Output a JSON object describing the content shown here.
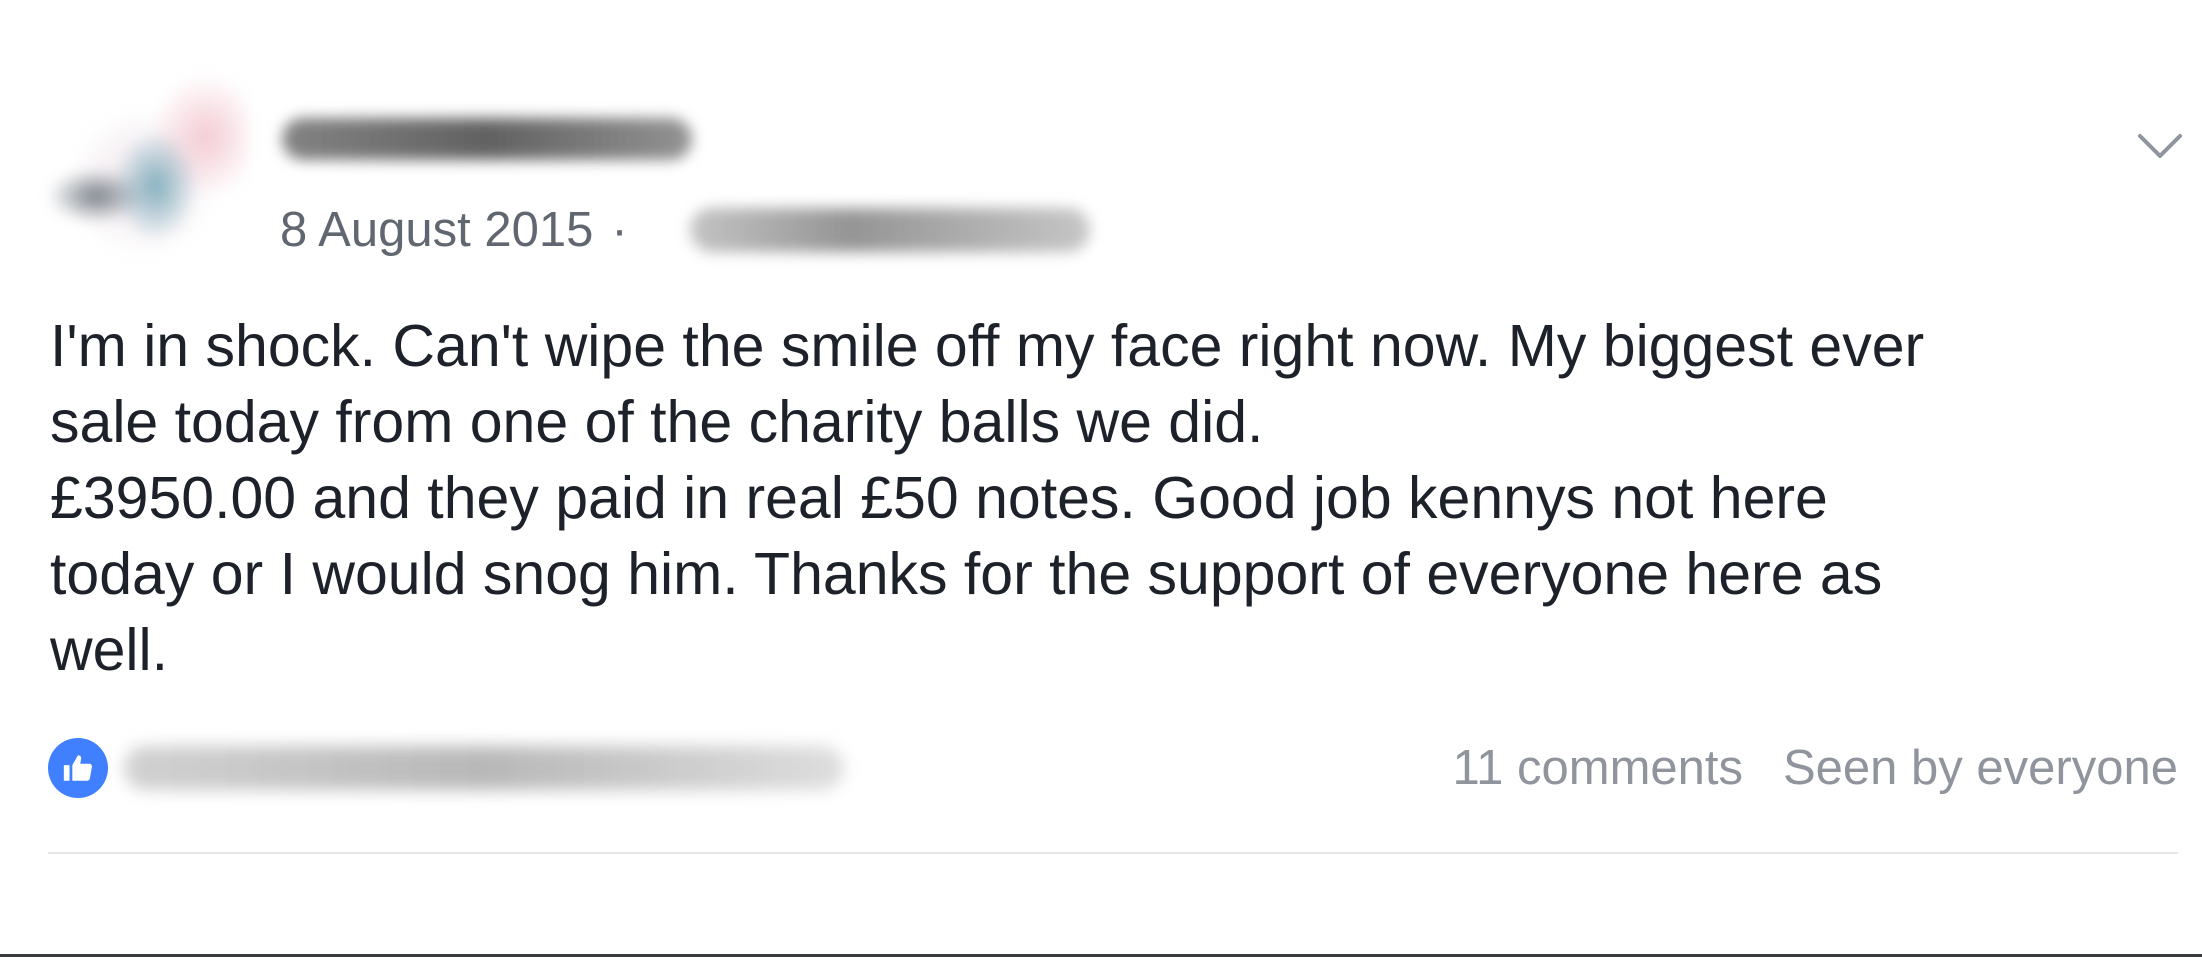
{
  "post": {
    "date": "8 August 2015",
    "separator": "·",
    "text_lines": [
      "I'm in shock. Can't wipe the smile off my face right now. My biggest ever",
      "sale today from one of the charity balls we did.",
      "£3950.00 and they paid in real £50 notes. Good job kennys not here",
      "today or I would snog him. Thanks for the support of everyone here as",
      "well."
    ],
    "comments_label": "11 comments",
    "seen_label": "Seen by everyone",
    "icons": {
      "menu": "chevron-down-icon",
      "reaction": "like-icon"
    },
    "colors": {
      "like_blue": "#4080ff",
      "meta_gray": "#616770",
      "stats_gray": "#90949c",
      "text": "#1d2129"
    }
  }
}
